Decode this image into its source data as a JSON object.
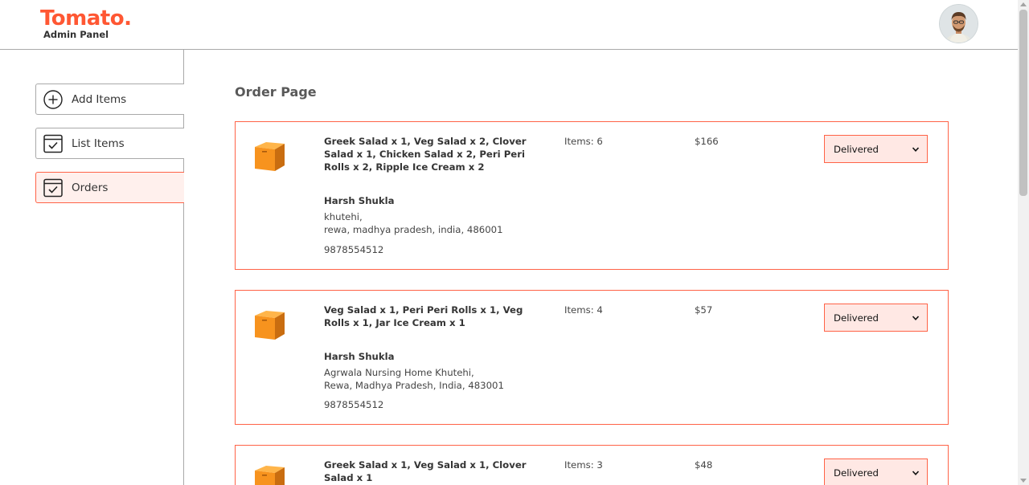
{
  "brand": {
    "title": "Tomato.",
    "subtitle": "Admin Panel"
  },
  "sidebar": {
    "items": [
      {
        "label": "Add Items",
        "icon": "add-circle-icon",
        "active": false
      },
      {
        "label": "List Items",
        "icon": "checklist-icon",
        "active": false
      },
      {
        "label": "Orders",
        "icon": "checklist-icon",
        "active": true
      }
    ]
  },
  "main": {
    "title": "Order Page",
    "orders": [
      {
        "items": "Greek Salad x 1, Veg Salad x 2, Clover Salad x 1, Chicken Salad x 2, Peri Peri Rolls x 2, Ripple Ice Cream x 2",
        "customer": "Harsh Shukla",
        "address_line1": "khutehi,",
        "address_line2": "rewa, madhya pradesh, india, 486001",
        "phone": "9878554512",
        "item_count": "Items: 6",
        "amount": "$166",
        "status": "Delivered"
      },
      {
        "items": "Veg Salad x 1, Peri Peri Rolls x 1, Veg Rolls x 1, Jar Ice Cream x 1",
        "customer": "Harsh Shukla",
        "address_line1": "Agrwala Nursing Home Khutehi,",
        "address_line2": "Rewa, Madhya Pradesh, India, 483001",
        "phone": "9878554512",
        "item_count": "Items: 4",
        "amount": "$57",
        "status": "Delivered"
      },
      {
        "items": "Greek Salad x 1, Veg Salad x 1, Clover Salad x 1",
        "item_count": "Items: 3",
        "amount": "$48",
        "status": "Delivered"
      }
    ]
  },
  "colors": {
    "accent": "#ff6347",
    "logo": "#ff5733",
    "active_bg": "#fff0ed",
    "parcel": "#f7931e"
  }
}
